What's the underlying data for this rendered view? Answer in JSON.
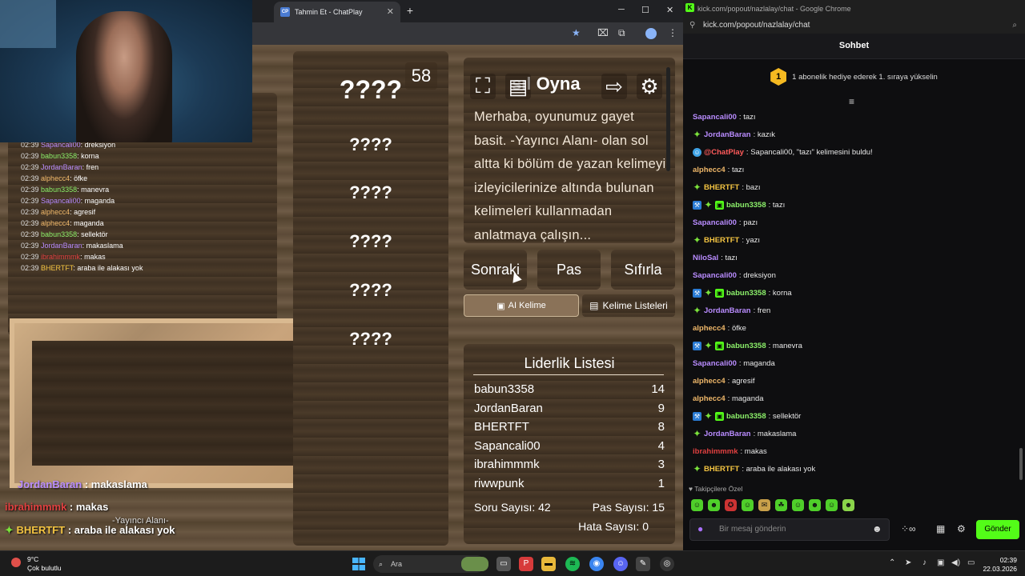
{
  "game_browser": {
    "tab_title": "Tahmin Et - ChatPlay",
    "tab_favicon": "CP",
    "tab_close": "✕",
    "new_tab": "+",
    "window_controls": [
      "─",
      "☐",
      "✕"
    ]
  },
  "overlay_chat": [
    {
      "time": "02:39",
      "user": "Sapancali00",
      "color": "#b98cff",
      "text": ": dreksiyon"
    },
    {
      "time": "02:39",
      "user": "babun3358",
      "color": "#8cf06a",
      "text": ": korna"
    },
    {
      "time": "02:39",
      "user": "JordanBaran",
      "color": "#b98cff",
      "text": ": fren"
    },
    {
      "time": "02:39",
      "user": "alphecc4",
      "color": "#f0b86a",
      "text": ": öfke"
    },
    {
      "time": "02:39",
      "user": "babun3358",
      "color": "#8cf06a",
      "text": ": manevra"
    },
    {
      "time": "02:39",
      "user": "Sapancali00",
      "color": "#b98cff",
      "text": ": maganda"
    },
    {
      "time": "02:39",
      "user": "alphecc4",
      "color": "#f0b86a",
      "text": ": agresif"
    },
    {
      "time": "02:39",
      "user": "alphecc4",
      "color": "#f0b86a",
      "text": ": maganda"
    },
    {
      "time": "02:39",
      "user": "babun3358",
      "color": "#8cf06a",
      "text": ": sellektör"
    },
    {
      "time": "02:39",
      "user": "JordanBaran",
      "color": "#b98cff",
      "text": ": makaslama"
    },
    {
      "time": "02:39",
      "user": "ibrahimmmk",
      "color": "#e04040",
      "text": ": makas"
    },
    {
      "time": "02:39",
      "user": "BHERTFT",
      "color": "#f5c542",
      "text": ": araba ile alakası yok"
    }
  ],
  "overlay_big": {
    "line1_user": "JordanBaran",
    "line1_text": " : makaslama",
    "line2_user": "ibrahimmmk",
    "line2_text": " : makas",
    "line3_user": "BHERTFT",
    "line3_text": " : araba ile alakası yok",
    "streamer_area": "-Yayıncı Alanı-"
  },
  "game": {
    "timer": "58",
    "hidden_words": [
      "????",
      "????",
      "????",
      "????",
      "????",
      "????"
    ],
    "info_title": "sıl Oyna",
    "info_text": "Merhaba, oyunumuz gayet basit. -Yayıncı Alanı- olan sol altta ki bölüm de yazan kelimeyi izleyicilerinize altında bulunan kelimeleri kullanmadan anlatmaya çalışın...",
    "icons": {
      "fullscreen": "⛶",
      "notes": "▤",
      "exit": "⇨",
      "settings": "⚙"
    },
    "buttons": {
      "next": "Sonraki",
      "pass": "Pas",
      "reset": "Sıfırla"
    },
    "ai_word": "AI Kelime",
    "word_lists": "Kelime Listeleri",
    "leaderboard_title": "Liderlik Listesi",
    "leaderboard": [
      {
        "name": "babun3358",
        "score": "14"
      },
      {
        "name": "JordanBaran",
        "score": "9"
      },
      {
        "name": "BHERTFT",
        "score": "8"
      },
      {
        "name": "Sapancali00",
        "score": "4"
      },
      {
        "name": "ibrahimmmk",
        "score": "3"
      },
      {
        "name": "riwwpunk",
        "score": "1"
      }
    ],
    "question_count": "Soru Sayısı: 42",
    "pass_count": "Pas Sayısı: 15",
    "error_count": "Hata Sayısı: 0"
  },
  "chat_browser": {
    "title": "kick.com/popout/nazlalay/chat - Google Chrome",
    "url": "kick.com/popout/nazlalay/chat",
    "header": "Sohbet",
    "gift_rank": "1",
    "gift_banner": "1 abonelik hediye ederek 1. sıraya yükselin",
    "messages": [
      {
        "user": "Sapancali00",
        "color": "#b98cff",
        "badges": [],
        "text": ": tazı"
      },
      {
        "user": "JordanBaran",
        "color": "#b98cff",
        "badges": [
          "star"
        ],
        "text": ": kazık"
      },
      {
        "user": "@ChatPlay",
        "color": "#ff5b5b",
        "badges": [
          "bot"
        ],
        "text": ": Sapancali00, \"tazı\" kelimesini buldu!"
      },
      {
        "user": "alphecc4",
        "color": "#f0b86a",
        "badges": [],
        "text": ": tazı"
      },
      {
        "user": "BHERTFT",
        "color": "#f5c542",
        "badges": [
          "star"
        ],
        "text": ": bazı"
      },
      {
        "user": "babun3358",
        "color": "#8cf06a",
        "badges": [
          "sub",
          "star",
          "gift"
        ],
        "text": ": tazı"
      },
      {
        "user": "Sapancali00",
        "color": "#b98cff",
        "badges": [],
        "text": ": pazı"
      },
      {
        "user": "BHERTFT",
        "color": "#f5c542",
        "badges": [
          "star"
        ],
        "text": ": yazı"
      },
      {
        "user": "NiloSal",
        "color": "#b98cff",
        "badges": [],
        "text": ": tazı"
      },
      {
        "user": "Sapancali00",
        "color": "#b98cff",
        "badges": [],
        "text": ": dreksiyon"
      },
      {
        "user": "babun3358",
        "color": "#8cf06a",
        "badges": [
          "sub",
          "star",
          "gift"
        ],
        "text": ": korna"
      },
      {
        "user": "JordanBaran",
        "color": "#b98cff",
        "badges": [
          "star"
        ],
        "text": ": fren"
      },
      {
        "user": "alphecc4",
        "color": "#f0b86a",
        "badges": [],
        "text": ": öfke"
      },
      {
        "user": "babun3358",
        "color": "#8cf06a",
        "badges": [
          "sub",
          "star",
          "gift"
        ],
        "text": ": manevra"
      },
      {
        "user": "Sapancali00",
        "color": "#b98cff",
        "badges": [],
        "text": ": maganda"
      },
      {
        "user": "alphecc4",
        "color": "#f0b86a",
        "badges": [],
        "text": ": agresif"
      },
      {
        "user": "alphecc4",
        "color": "#f0b86a",
        "badges": [],
        "text": ": maganda"
      },
      {
        "user": "babun3358",
        "color": "#8cf06a",
        "badges": [
          "sub",
          "star",
          "gift"
        ],
        "text": ": sellektör"
      },
      {
        "user": "JordanBaran",
        "color": "#b98cff",
        "badges": [
          "star"
        ],
        "text": ": makaslama"
      },
      {
        "user": "ibrahimmmk",
        "color": "#e04040",
        "badges": [],
        "text": ": makas"
      },
      {
        "user": "BHERTFT",
        "color": "#f5c542",
        "badges": [
          "star"
        ],
        "text": ": araba ile alakası yok"
      }
    ],
    "followers_only": "♥ Takipçilere Özel",
    "input_placeholder": "Bir mesaj gönderin",
    "send": "Gönder"
  },
  "taskbar": {
    "temp": "9°C",
    "weather": "Çok bulutlu",
    "search": "Ara",
    "time": "02:39",
    "date": "22.03.2026"
  }
}
